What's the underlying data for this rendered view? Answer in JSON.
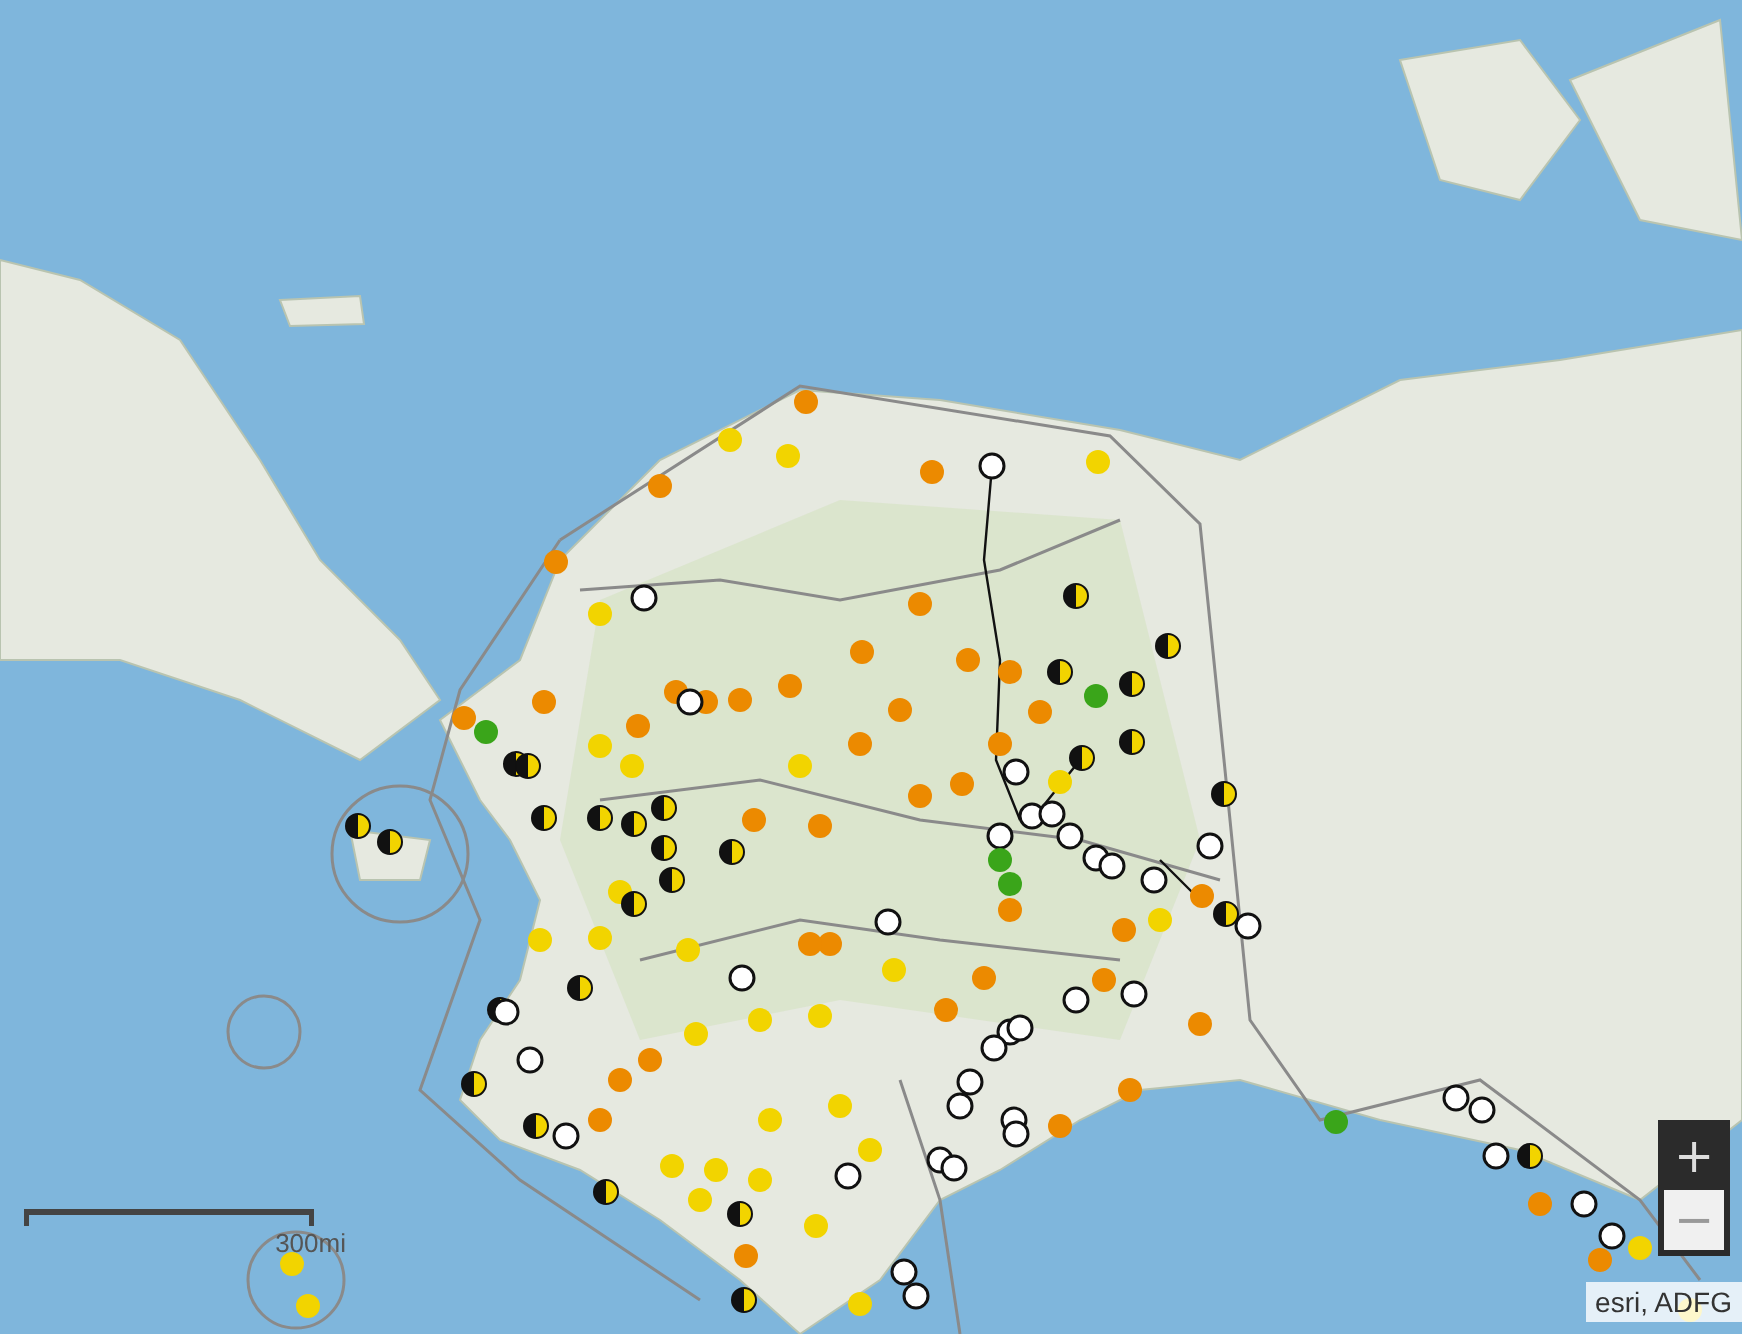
{
  "scale_bar": {
    "label": "300mi"
  },
  "zoom_controls": [
    {
      "label": "+",
      "disabled": false
    },
    {
      "label": "−",
      "disabled": true
    }
  ],
  "attribution": "esri, ADFG"
}
